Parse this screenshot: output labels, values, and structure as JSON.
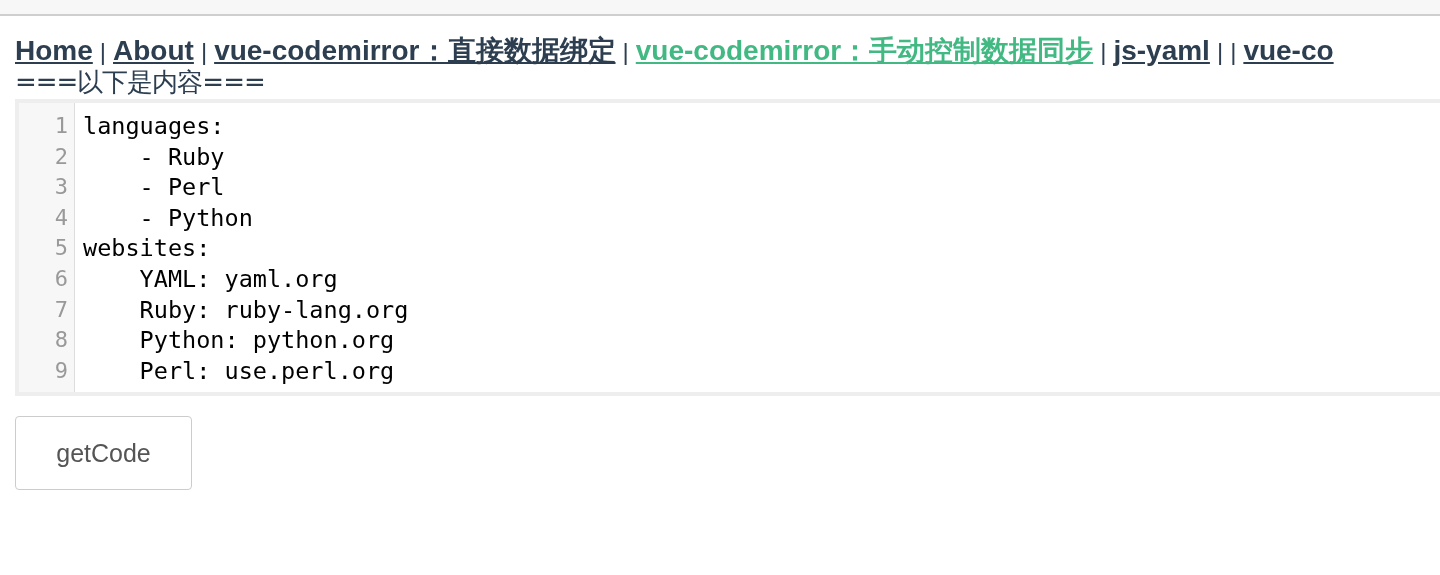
{
  "nav": [
    {
      "kind": "link",
      "text": "Home",
      "selected": false
    },
    {
      "kind": "separator",
      "text": "|"
    },
    {
      "kind": "link",
      "text": "About",
      "selected": false
    },
    {
      "kind": "separator",
      "text": "|"
    },
    {
      "kind": "link",
      "text": "vue-codemirror：直接数据绑定",
      "selected": false
    },
    {
      "kind": "separator",
      "text": "|"
    },
    {
      "kind": "link",
      "text": "vue-codemirror：手动控制数据同步",
      "selected": true
    },
    {
      "kind": "separator",
      "text": "|"
    },
    {
      "kind": "link",
      "text": "js-yaml",
      "selected": false
    },
    {
      "kind": "separator",
      "text": "|"
    },
    {
      "kind": "separator",
      "text": "|"
    },
    {
      "kind": "link",
      "text": "vue-co",
      "selected": false
    }
  ],
  "heading": "===以下是内容===",
  "editor": {
    "lines": [
      {
        "number": "1",
        "code": "languages:"
      },
      {
        "number": "2",
        "code": "    - Ruby"
      },
      {
        "number": "3",
        "code": "    - Perl"
      },
      {
        "number": "4",
        "code": "    - Python"
      },
      {
        "number": "5",
        "code": "websites:"
      },
      {
        "number": "6",
        "code": "    YAML: yaml.org"
      },
      {
        "number": "7",
        "code": "    Ruby: ruby-lang.org"
      },
      {
        "number": "8",
        "code": "    Python: python.org"
      },
      {
        "number": "9",
        "code": "    Perl: use.perl.org"
      }
    ]
  },
  "button": "getCode"
}
